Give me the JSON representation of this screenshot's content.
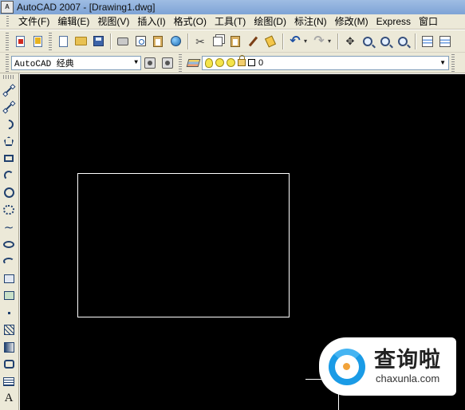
{
  "window": {
    "title": "AutoCAD 2007 - [Drawing1.dwg]",
    "app_icon": "A"
  },
  "menubar": {
    "items": [
      {
        "label": "文件(F)"
      },
      {
        "label": "编辑(E)"
      },
      {
        "label": "视图(V)"
      },
      {
        "label": "插入(I)"
      },
      {
        "label": "格式(O)"
      },
      {
        "label": "工具(T)"
      },
      {
        "label": "绘图(D)"
      },
      {
        "label": "标注(N)"
      },
      {
        "label": "修改(M)"
      },
      {
        "label": "Express"
      },
      {
        "label": "窗口"
      }
    ]
  },
  "toolbar_standard": {
    "icons": [
      "new-drawing-red-icon",
      "sheet-set-icon",
      "new-icon",
      "open-icon",
      "save-icon",
      "plot-icon",
      "plot-preview-icon",
      "publish-icon",
      "3d-dwf-icon",
      "cut-icon",
      "copy-icon",
      "paste-icon",
      "match-properties-icon",
      "block-editor-icon",
      "undo-icon",
      "redo-icon",
      "pan-icon",
      "zoom-realtime-icon",
      "zoom-window-icon",
      "zoom-previous-icon",
      "properties-icon",
      "design-center-icon"
    ]
  },
  "workspace": {
    "selected": "AutoCAD 经典"
  },
  "layer": {
    "current": "0"
  },
  "draw_toolbar": {
    "tools": [
      "line",
      "construction-line",
      "polyline",
      "polygon",
      "rectangle",
      "arc",
      "circle",
      "revision-cloud",
      "spline",
      "ellipse",
      "ellipse-arc",
      "insert-block",
      "make-block",
      "point",
      "hatch",
      "gradient",
      "region",
      "table",
      "multiline-text"
    ],
    "text_tool_label": "A"
  },
  "watermark": {
    "brand": "查询啦",
    "url": "chaxunla.com"
  },
  "colors": {
    "canvas": "#000000",
    "drawing_lines": "#ffffff",
    "chrome": "#ece9d8",
    "titlebar": "#7ea3d6",
    "watermark_blue": "#1a9be6",
    "watermark_orange": "#f2a33a"
  }
}
